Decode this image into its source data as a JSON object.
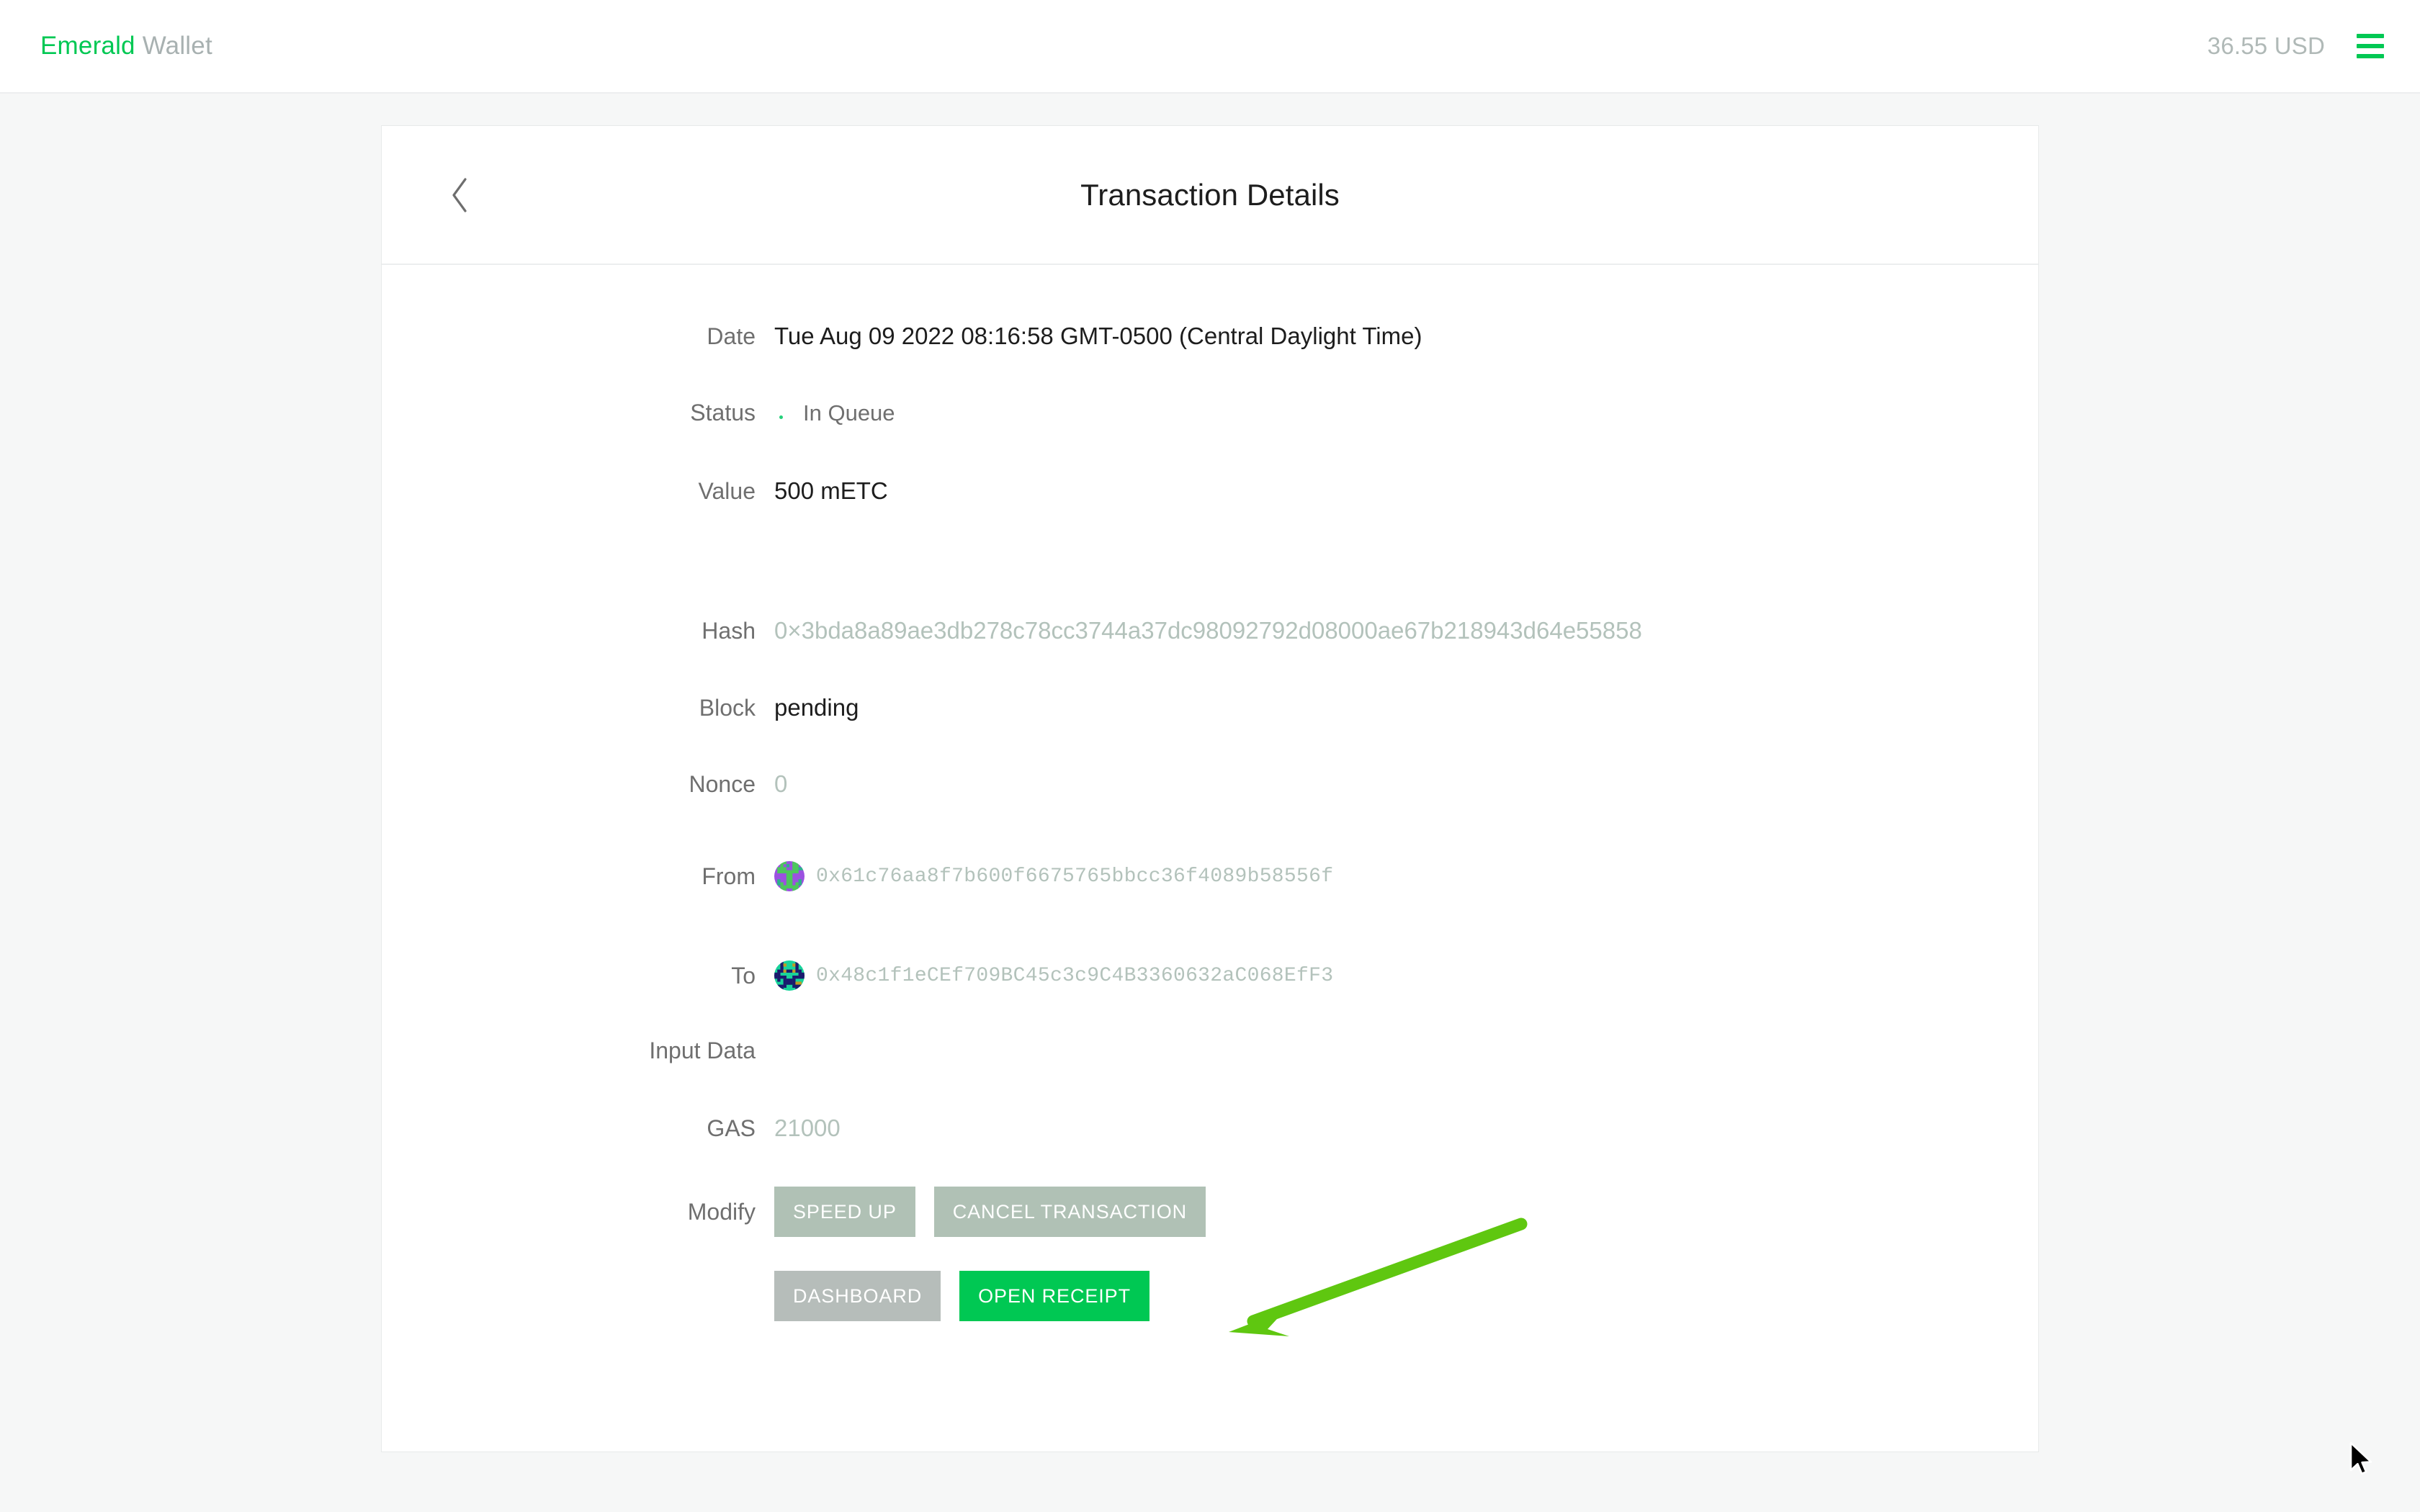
{
  "topbar": {
    "brand_primary": "Emerald",
    "brand_secondary": "Wallet",
    "fiat_balance": "36.55 USD",
    "menu_icon": "hamburger-icon",
    "accent_color": "#00c853"
  },
  "card": {
    "title": "Transaction Details",
    "back_icon": "chevron-left-icon"
  },
  "details": {
    "date": {
      "label": "Date",
      "value": "Tue Aug 09 2022 08:16:58 GMT-0500 (Central Daylight Time)"
    },
    "status": {
      "label": "Status",
      "value": "In Queue",
      "indicator_icon": "spinner-icon",
      "indicator_color": "#25d07a"
    },
    "value": {
      "label": "Value",
      "value": "500 mETC"
    },
    "hash": {
      "label": "Hash",
      "value": "0×3bda8a89ae3db278c78cc3744a37dc98092792d08000ae67b218943d64e55858"
    },
    "block": {
      "label": "Block",
      "value": "pending"
    },
    "nonce": {
      "label": "Nonce",
      "value": "0"
    },
    "from": {
      "label": "From",
      "value": "0x61c76aa8f7b600f6675765bbcc36f4089b58556f",
      "avatar_icon": "identicon-avatar"
    },
    "to": {
      "label": "To",
      "value": "0x48c1f1eCEf709BC45c3c9C4B3360632aC068EfF3",
      "avatar_icon": "identicon-avatar"
    },
    "input_data": {
      "label": "Input Data",
      "value": ""
    },
    "gas": {
      "label": "GAS",
      "value": "21000"
    },
    "modify": {
      "label": "Modify"
    }
  },
  "buttons": {
    "speed_up": "SPEED UP",
    "cancel_transaction": "CANCEL TRANSACTION",
    "dashboard": "DASHBOARD",
    "open_receipt": "OPEN RECEIPT"
  },
  "annotation": {
    "arrow_color": "#5fc710",
    "points_to": "OPEN RECEIPT"
  },
  "identicons": {
    "from": {
      "bg": "#9b51e0",
      "fg": "#4cc95b",
      "spot": "#2bb38a",
      "grid": [
        [
          0,
          0,
          1,
          1,
          0,
          0,
          1,
          1,
          0,
          0
        ],
        [
          0,
          0,
          1,
          0,
          2,
          0,
          1,
          1,
          0,
          0
        ],
        [
          0,
          1,
          1,
          1,
          0,
          0,
          1,
          1,
          2,
          2
        ],
        [
          0,
          1,
          1,
          1,
          1,
          1,
          1,
          1,
          0,
          0
        ],
        [
          0,
          0,
          0,
          0,
          1,
          1,
          0,
          0,
          0,
          0
        ],
        [
          0,
          0,
          0,
          0,
          1,
          1,
          0,
          0,
          0,
          0
        ],
        [
          0,
          2,
          0,
          0,
          1,
          1,
          0,
          0,
          2,
          0
        ],
        [
          0,
          2,
          1,
          0,
          1,
          1,
          0,
          1,
          2,
          0
        ],
        [
          0,
          0,
          1,
          1,
          1,
          1,
          1,
          1,
          0,
          0
        ],
        [
          0,
          0,
          1,
          1,
          0,
          0,
          1,
          1,
          0,
          0
        ]
      ]
    },
    "to": {
      "bg": "#18d39a",
      "fg": "#1a1a6e",
      "spot": "#c19a22",
      "grid": [
        [
          0,
          0,
          1,
          0,
          0,
          0,
          0,
          1,
          0,
          0
        ],
        [
          0,
          0,
          1,
          2,
          0,
          0,
          2,
          1,
          0,
          0
        ],
        [
          0,
          0,
          1,
          0,
          0,
          0,
          0,
          1,
          0,
          0
        ],
        [
          0,
          1,
          1,
          2,
          1,
          1,
          2,
          1,
          1,
          0
        ],
        [
          1,
          1,
          0,
          0,
          0,
          0,
          0,
          0,
          1,
          1
        ],
        [
          1,
          1,
          1,
          1,
          0,
          0,
          1,
          1,
          1,
          1
        ],
        [
          0,
          1,
          0,
          1,
          1,
          1,
          1,
          0,
          0,
          0
        ],
        [
          0,
          0,
          0,
          1,
          1,
          1,
          1,
          2,
          2,
          0
        ],
        [
          0,
          1,
          1,
          1,
          0,
          0,
          1,
          1,
          1,
          0
        ],
        [
          0,
          1,
          1,
          0,
          0,
          0,
          0,
          1,
          1,
          0
        ]
      ]
    }
  }
}
